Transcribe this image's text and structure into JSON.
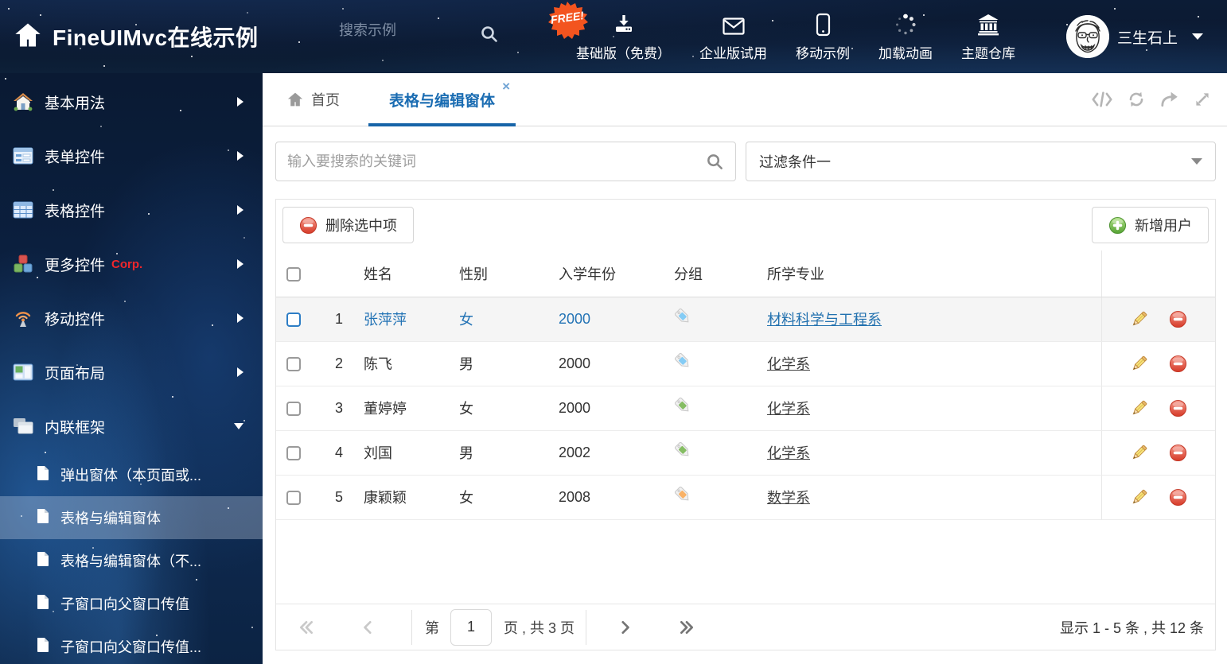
{
  "colors": {
    "accent_blue": "#1a6cb2",
    "link_blue": "#2373b5",
    "badge_orange": "#f3541f",
    "danger_red": "#d9402e",
    "success_green": "#5fae3c",
    "tag_blue": "#85ccf5",
    "tag_green": "#85bd63",
    "tag_orange": "#f9b267"
  },
  "header": {
    "title": "FineUIMvc在线示例",
    "search_placeholder": "搜索示例",
    "free_badge": "FREE!",
    "nav_items": [
      {
        "label": "基础版（免费）",
        "icon": "download-icon"
      },
      {
        "label": "企业版试用",
        "icon": "envelope-icon"
      },
      {
        "label": "移动示例",
        "icon": "mobile-icon"
      },
      {
        "label": "加载动画",
        "icon": "spinner-icon"
      },
      {
        "label": "主题仓库",
        "icon": "bank-icon"
      }
    ],
    "user_name": "三生石上"
  },
  "sidebar": {
    "items": [
      {
        "label": "基本用法",
        "icon": "home-icon"
      },
      {
        "label": "表单控件",
        "icon": "form-icon"
      },
      {
        "label": "表格控件",
        "icon": "grid-icon"
      },
      {
        "label": "更多控件",
        "icon": "cubes-icon"
      },
      {
        "label": "移动控件",
        "badge": "Corp.",
        "icon": "antenna-icon"
      },
      {
        "label": "页面布局",
        "icon": "layout-icon"
      },
      {
        "label": "内联框架",
        "icon": "frames-icon",
        "expanded": true,
        "children": [
          {
            "label": "弹出窗体（本页面或..."
          },
          {
            "label": "表格与编辑窗体",
            "active": true
          },
          {
            "label": "表格与编辑窗体（不..."
          },
          {
            "label": "子窗口向父窗口传值"
          },
          {
            "label": "子窗口向父窗口传值..."
          }
        ]
      }
    ]
  },
  "tabs": {
    "home_label": "首页",
    "active_label": "表格与编辑窗体"
  },
  "filter_bar": {
    "search_placeholder": "输入要搜索的关键词",
    "filter_value": "过滤条件一"
  },
  "toolbar": {
    "delete_label": "删除选中项",
    "add_label": "新增用户"
  },
  "table": {
    "columns": [
      "姓名",
      "性别",
      "入学年份",
      "分组",
      "所学专业"
    ],
    "rows": [
      {
        "index": "1",
        "name": "张萍萍",
        "gender": "女",
        "year": "2000",
        "tag_color": "#85ccf5",
        "major": "材料科学与工程系",
        "selected": true
      },
      {
        "index": "2",
        "name": "陈飞",
        "gender": "男",
        "year": "2000",
        "tag_color": "#85ccf5",
        "major": "化学系",
        "selected": false
      },
      {
        "index": "3",
        "name": "董婷婷",
        "gender": "女",
        "year": "2000",
        "tag_color": "#85bd63",
        "major": "化学系",
        "selected": false
      },
      {
        "index": "4",
        "name": "刘国",
        "gender": "男",
        "year": "2002",
        "tag_color": "#85bd63",
        "major": "化学系",
        "selected": false
      },
      {
        "index": "5",
        "name": "康颖颖",
        "gender": "女",
        "year": "2008",
        "tag_color": "#f9b267",
        "major": "数学系",
        "selected": false
      }
    ]
  },
  "pagination": {
    "prefix": "第",
    "current_page": "1",
    "suffix": "页 , 共 3 页",
    "summary": "显示 1 - 5 条 , 共 12 条"
  }
}
